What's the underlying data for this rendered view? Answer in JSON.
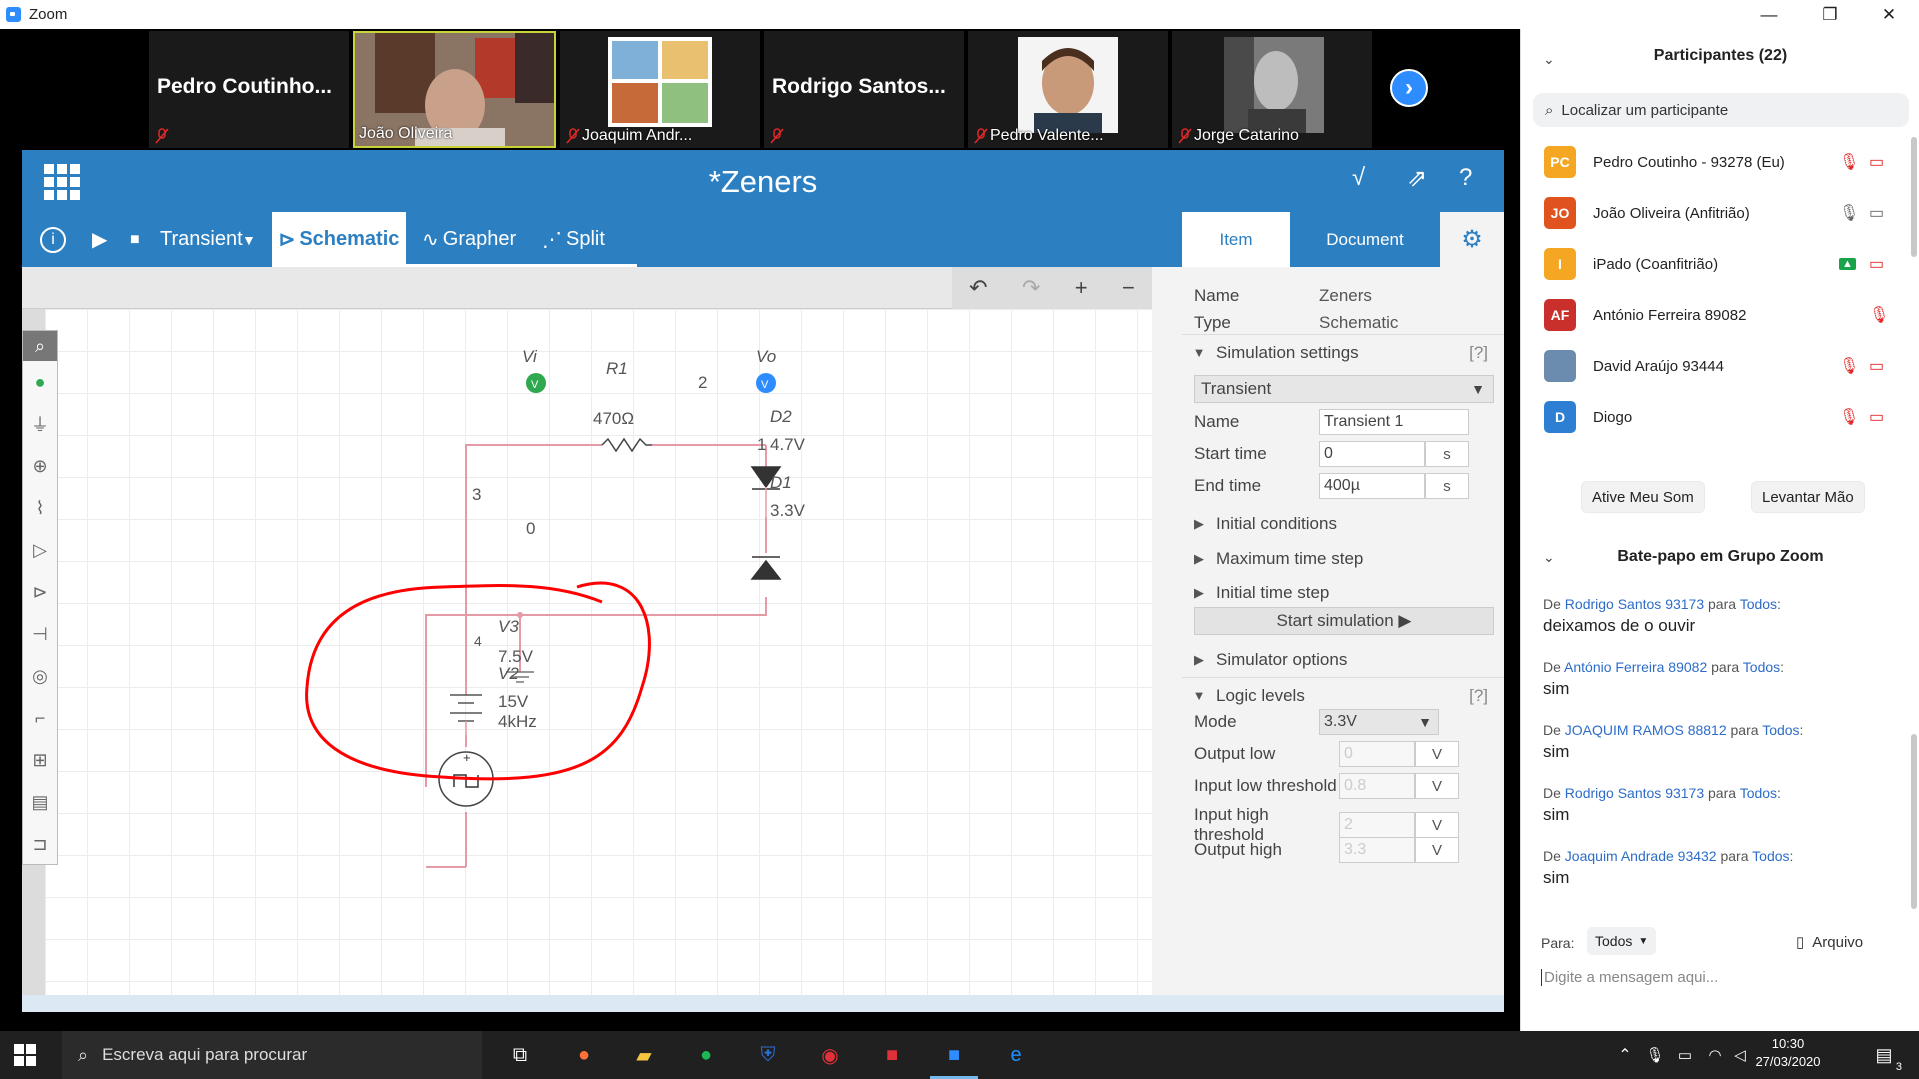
{
  "window": {
    "title": "Zoom",
    "controls": [
      "—",
      "❐",
      "✕"
    ]
  },
  "thumbnails": [
    {
      "big_name": "Pedro Coutinho...",
      "label": ""
    },
    {
      "big_name": "",
      "label": "João Oliveira"
    },
    {
      "big_name": "",
      "label": "Joaquim Andr..."
    },
    {
      "big_name": "Rodrigo Santos...",
      "label": ""
    },
    {
      "big_name": "",
      "label": "Pedro Valente..."
    },
    {
      "big_name": "",
      "label": "Jorge Catarino"
    }
  ],
  "app": {
    "title": "*Zeners",
    "toolbar": {
      "info": "i",
      "play": "▶",
      "stop": "■",
      "mode": "Transient",
      "mode_arrow": "▼",
      "tab_schematic": "Schematic",
      "tab_grapher": "Grapher",
      "tab_split": "Split"
    },
    "top_icons": [
      "√",
      "⇗",
      "?"
    ],
    "edit_toolbar": [
      "↶",
      "↷",
      "+",
      "−"
    ],
    "schematic": {
      "labels": {
        "vi": "Vi",
        "vo": "Vo",
        "r1": "R1",
        "r1_value": "470Ω",
        "node2": "2",
        "node3": "3",
        "node0": "0",
        "node1": "1",
        "d2": "D2",
        "d2_value": "4.7V",
        "d1": "D1",
        "d1_value": "3.3V",
        "v3": "V3",
        "v3_value": "7.5V",
        "v2": "V2",
        "v2_value": "15V",
        "v2_freq": "4kHz",
        "node4": "4",
        "probe_v": "V"
      }
    },
    "props": {
      "tab_item": "Item",
      "tab_document": "Document",
      "gear": "⚙",
      "name_key": "Name",
      "name_val": "Zeners",
      "type_key": "Type",
      "type_val": "Schematic",
      "sim_settings": "Simulation settings",
      "help": "[?]",
      "sim_type": "Transient",
      "sim_name_key": "Name",
      "sim_name_val": "Transient 1",
      "start_time_key": "Start time",
      "start_time_val": "0",
      "start_time_unit": "s",
      "end_time_key": "End time",
      "end_time_val": "400µ",
      "end_time_unit": "s",
      "initial_conditions": "Initial conditions",
      "max_time_step": "Maximum time step",
      "initial_time_step": "Initial time step",
      "start_simulation": "Start simulation ▶",
      "simulator_options": "Simulator options",
      "logic_levels": "Logic levels",
      "mode_key": "Mode",
      "mode_val": "3.3V",
      "output_low": "Output low",
      "output_low_val": "0",
      "input_low_threshold": "Input low threshold",
      "input_low_threshold_val": "0.8",
      "input_high_threshold": "Input high threshold",
      "input_high_threshold_val": "2",
      "output_high": "Output high",
      "output_high_val": "3.3",
      "unit_v": "V"
    }
  },
  "participants_panel": {
    "title": "Participantes (22)",
    "search_placeholder": "Localizar um participante",
    "participants": [
      {
        "initials": "PC",
        "name": "Pedro Coutinho - 93278 (Eu)",
        "color": "#f5a623"
      },
      {
        "initials": "JO",
        "name": "João Oliveira (Anfitrião)",
        "color": "#e0531f"
      },
      {
        "initials": "I",
        "name": "iPado (Coanfitrião)",
        "color": "#f5a623"
      },
      {
        "initials": "AF",
        "name": "António Ferreira 89082",
        "color": "#c9302c"
      },
      {
        "initials": "",
        "name": "David Araújo 93444",
        "color": "#6b8cae"
      },
      {
        "initials": "D",
        "name": "Diogo",
        "color": "#2d7fd3"
      }
    ],
    "unmute_btn": "Ative Meu Som",
    "raise_hand_btn": "Levantar Mão"
  },
  "chat": {
    "title": "Bate-papo em Grupo Zoom",
    "messages": [
      {
        "from": "Rodrigo Santos 93173",
        "to": "Todos",
        "text": "deixamos de o ouvir"
      },
      {
        "from": "António Ferreira 89082",
        "to": "Todos",
        "text": "sim"
      },
      {
        "from": "JOAQUIM RAMOS 88812",
        "to": "Todos",
        "text": "sim"
      },
      {
        "from": "Rodrigo Santos 93173",
        "to": "Todos",
        "text": "sim"
      },
      {
        "from": "Joaquim Andrade 93432",
        "to": "Todos",
        "text": "sim"
      }
    ],
    "de": "De",
    "para": "para",
    "to_label": "Para:",
    "to_value": "Todos",
    "file_label": "Arquivo",
    "input_placeholder": "Digite a mensagem aqui..."
  },
  "taskbar": {
    "search_placeholder": "Escreva aqui para procurar",
    "time": "10:30",
    "date": "27/03/2020",
    "notifications": "3"
  },
  "colors": {
    "app_blue": "#2c7fc1",
    "wire_pink": "#e59aa7",
    "annotation_red": "#ff0000",
    "zoom_blue": "#2d8cff"
  }
}
